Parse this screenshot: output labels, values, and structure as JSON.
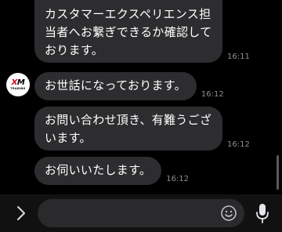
{
  "conversation": {
    "messages": [
      {
        "lines": [
          "カスタマーエクスペリエンス担",
          "当者へお繋ぎできるか確認して",
          "おります。"
        ],
        "time": "16:11"
      },
      {
        "lines": [
          "お世話になっております。"
        ],
        "time": "16:12"
      },
      {
        "lines": [
          "お問い合わせ頂き、有難うござ",
          "います。"
        ],
        "time": "16:12"
      },
      {
        "lines": [
          "お伺いいたします。"
        ],
        "time": "16:12"
      }
    ],
    "sender_avatar": {
      "logo_text_main_left": "X",
      "logo_text_main_right": "M",
      "logo_text_sub": "TRADING"
    }
  },
  "composer": {
    "input_value": "",
    "icons": {
      "expand": "chevron-right-icon",
      "emoji": "emoji-icon",
      "mic": "microphone-icon"
    }
  },
  "colors": {
    "background": "#000000",
    "bubble": "#2d2d2f",
    "timestamp": "#8e8e93",
    "input_bar": "#111112",
    "input_field": "#2a2a2c",
    "brand_red": "#d0021b"
  }
}
